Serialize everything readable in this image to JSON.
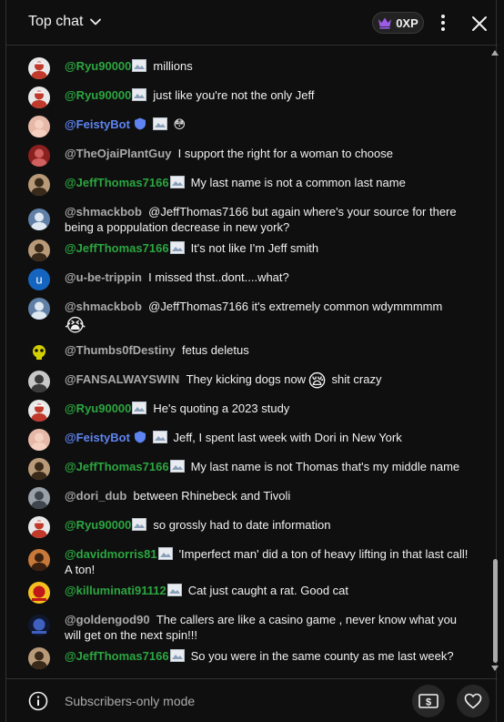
{
  "header": {
    "title": "Top chat",
    "xp_label": "0XP"
  },
  "footer": {
    "mode_text": "Subscribers-only mode"
  },
  "messages": [
    {
      "author": "@Ryu90000",
      "kind": "member",
      "text": "millions",
      "avatar": {
        "bg": "#e8e8e8",
        "fg": "#c0392b",
        "icon": "fighter-avatar"
      }
    },
    {
      "author": "@Ryu90000",
      "kind": "member",
      "text": "just like you're not the only Jeff",
      "avatar": {
        "bg": "#e8e8e8",
        "fg": "#c0392b",
        "icon": "fighter-avatar"
      }
    },
    {
      "author": "@FeistyBot",
      "kind": "mod",
      "text": "😳",
      "avatar": {
        "bg": "#e6b8a8",
        "fg": "#f4d0c0",
        "icon": "person-avatar"
      }
    },
    {
      "author": "@TheOjaiPlantGuy",
      "kind": "plain",
      "text": "I support the right for a woman to choose",
      "avatar": {
        "bg": "#8b2020",
        "fg": "#d06060",
        "icon": "person-avatar"
      }
    },
    {
      "author": "@JeffThomas7166",
      "kind": "member",
      "text": "My last name is not a common last name",
      "avatar": {
        "bg": "#b89a78",
        "fg": "#3a2a1a",
        "icon": "person-avatar"
      }
    },
    {
      "author": "@shmackbob",
      "kind": "plain",
      "text": "@JeffThomas7166 but again where's your source for there being a poppulation decrease in new york?",
      "avatar": {
        "bg": "#6080a8",
        "fg": "#dfe8f0",
        "icon": "person-avatar"
      }
    },
    {
      "author": "@JeffThomas7166",
      "kind": "member",
      "text": "It's not like I'm Jeff smith",
      "avatar": {
        "bg": "#b89a78",
        "fg": "#3a2a1a",
        "icon": "person-avatar"
      }
    },
    {
      "author": "@u-be-trippin",
      "kind": "plain",
      "text": "I missed thst..dont....what?",
      "avatar": {
        "bg": "#1565c0",
        "fg": "#ffffff",
        "icon": "letter-avatar",
        "letter": "u"
      }
    },
    {
      "author": "@shmackbob",
      "kind": "plain",
      "text": "@JeffThomas7166 it's extremely common wdymmmmm",
      "emoji_line2": "😭",
      "avatar": {
        "bg": "#6080a8",
        "fg": "#dfe8f0",
        "icon": "person-avatar"
      }
    },
    {
      "author": "@Thumbs0fDestiny",
      "kind": "plain",
      "text": "fetus deletus",
      "avatar": {
        "bg": "#101010",
        "fg": "#d4d000",
        "icon": "skull-avatar"
      }
    },
    {
      "author": "@FANSALWAYSWIN",
      "kind": "plain",
      "text": "They kicking dogs now",
      "emoji_inline": "😪",
      "text_after": "shit crazy",
      "avatar": {
        "bg": "#c8c8c8",
        "fg": "#3a3a3a",
        "icon": "person-avatar"
      }
    },
    {
      "author": "@Ryu90000",
      "kind": "member",
      "text": "He's quoting a 2023 study",
      "avatar": {
        "bg": "#e8e8e8",
        "fg": "#c0392b",
        "icon": "fighter-avatar"
      }
    },
    {
      "author": "@FeistyBot",
      "kind": "mod",
      "text": "Jeff, I spent last week with Dori in New York",
      "avatar": {
        "bg": "#e6b8a8",
        "fg": "#f4d0c0",
        "icon": "person-avatar"
      }
    },
    {
      "author": "@JeffThomas7166",
      "kind": "member",
      "text": "My last name is not Thomas that's my middle name",
      "avatar": {
        "bg": "#b89a78",
        "fg": "#3a2a1a",
        "icon": "person-avatar"
      }
    },
    {
      "author": "@dori_dub",
      "kind": "plain",
      "text": "between Rhinebeck and Tivoli",
      "avatar": {
        "bg": "#9aa0a8",
        "fg": "#40464e",
        "icon": "person-avatar"
      }
    },
    {
      "author": "@Ryu90000",
      "kind": "member",
      "text": "so grossly had to date information",
      "avatar": {
        "bg": "#e8e8e8",
        "fg": "#c0392b",
        "icon": "fighter-avatar"
      }
    },
    {
      "author": "@davidmorris81",
      "kind": "member",
      "text": "'Imperfect man' did a ton of heavy lifting in that last call! A ton!",
      "avatar": {
        "bg": "#c87838",
        "fg": "#3a2010",
        "icon": "person-avatar"
      }
    },
    {
      "author": "@killuminati91112",
      "kind": "member",
      "text": "Cat just caught a rat. Good cat",
      "avatar": {
        "bg": "#f4c020",
        "fg": "#c01818",
        "icon": "logo-avatar"
      }
    },
    {
      "author": "@goldengod90",
      "kind": "plain",
      "text": "The callers are like a casino game , never know what you will get on the next spin!!!",
      "avatar": {
        "bg": "#101830",
        "fg": "#4060c0",
        "icon": "logo-avatar"
      }
    },
    {
      "author": "@JeffThomas7166",
      "kind": "member",
      "text": "So you were in the same county as me last week?",
      "avatar": {
        "bg": "#b89a78",
        "fg": "#3a2a1a",
        "icon": "person-avatar"
      }
    }
  ],
  "colors": {
    "background": "#0f0f0f",
    "member_name": "#2ba640",
    "moderator_name": "#5e84f1",
    "plain_name": "#aaaaaa",
    "xp_crown": "#9b5de5"
  }
}
